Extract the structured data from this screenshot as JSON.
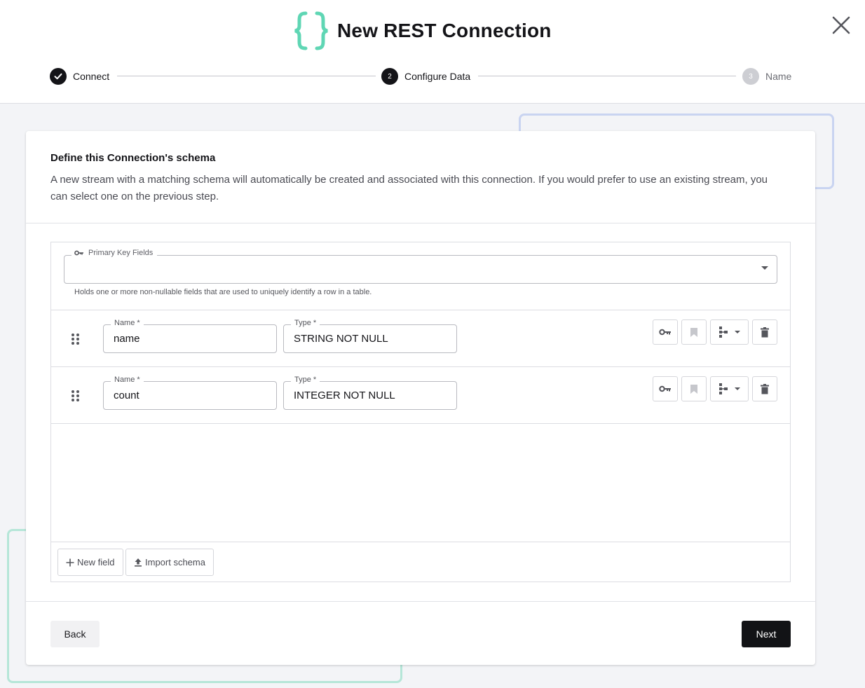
{
  "header": {
    "title": "New REST Connection",
    "icon": "curly-braces-icon",
    "accent_color": "#5fd6b4"
  },
  "stepper": {
    "steps": [
      {
        "label": "Connect",
        "state": "completed",
        "number": ""
      },
      {
        "label": "Configure Data",
        "state": "active",
        "number": "2"
      },
      {
        "label": "Name",
        "state": "pending",
        "number": "3"
      }
    ]
  },
  "card": {
    "title": "Define this Connection's schema",
    "description": "A new stream with a matching schema will automatically be created and associated with this connection. If you would prefer to use an existing stream, you can select one on the previous step."
  },
  "primary_key": {
    "label": "Primary Key Fields",
    "value": "",
    "helper": "Holds one or more non-nullable fields that are used to uniquely identify a row in a table."
  },
  "fields": [
    {
      "name_label": "Name *",
      "name_value": "name",
      "type_label": "Type *",
      "type_value": "STRING NOT NULL"
    },
    {
      "name_label": "Name *",
      "name_value": "count",
      "type_label": "Type *",
      "type_value": "INTEGER NOT NULL"
    }
  ],
  "actions": {
    "new_field": "New field",
    "import_schema": "Import schema"
  },
  "footer": {
    "back": "Back",
    "next": "Next"
  }
}
